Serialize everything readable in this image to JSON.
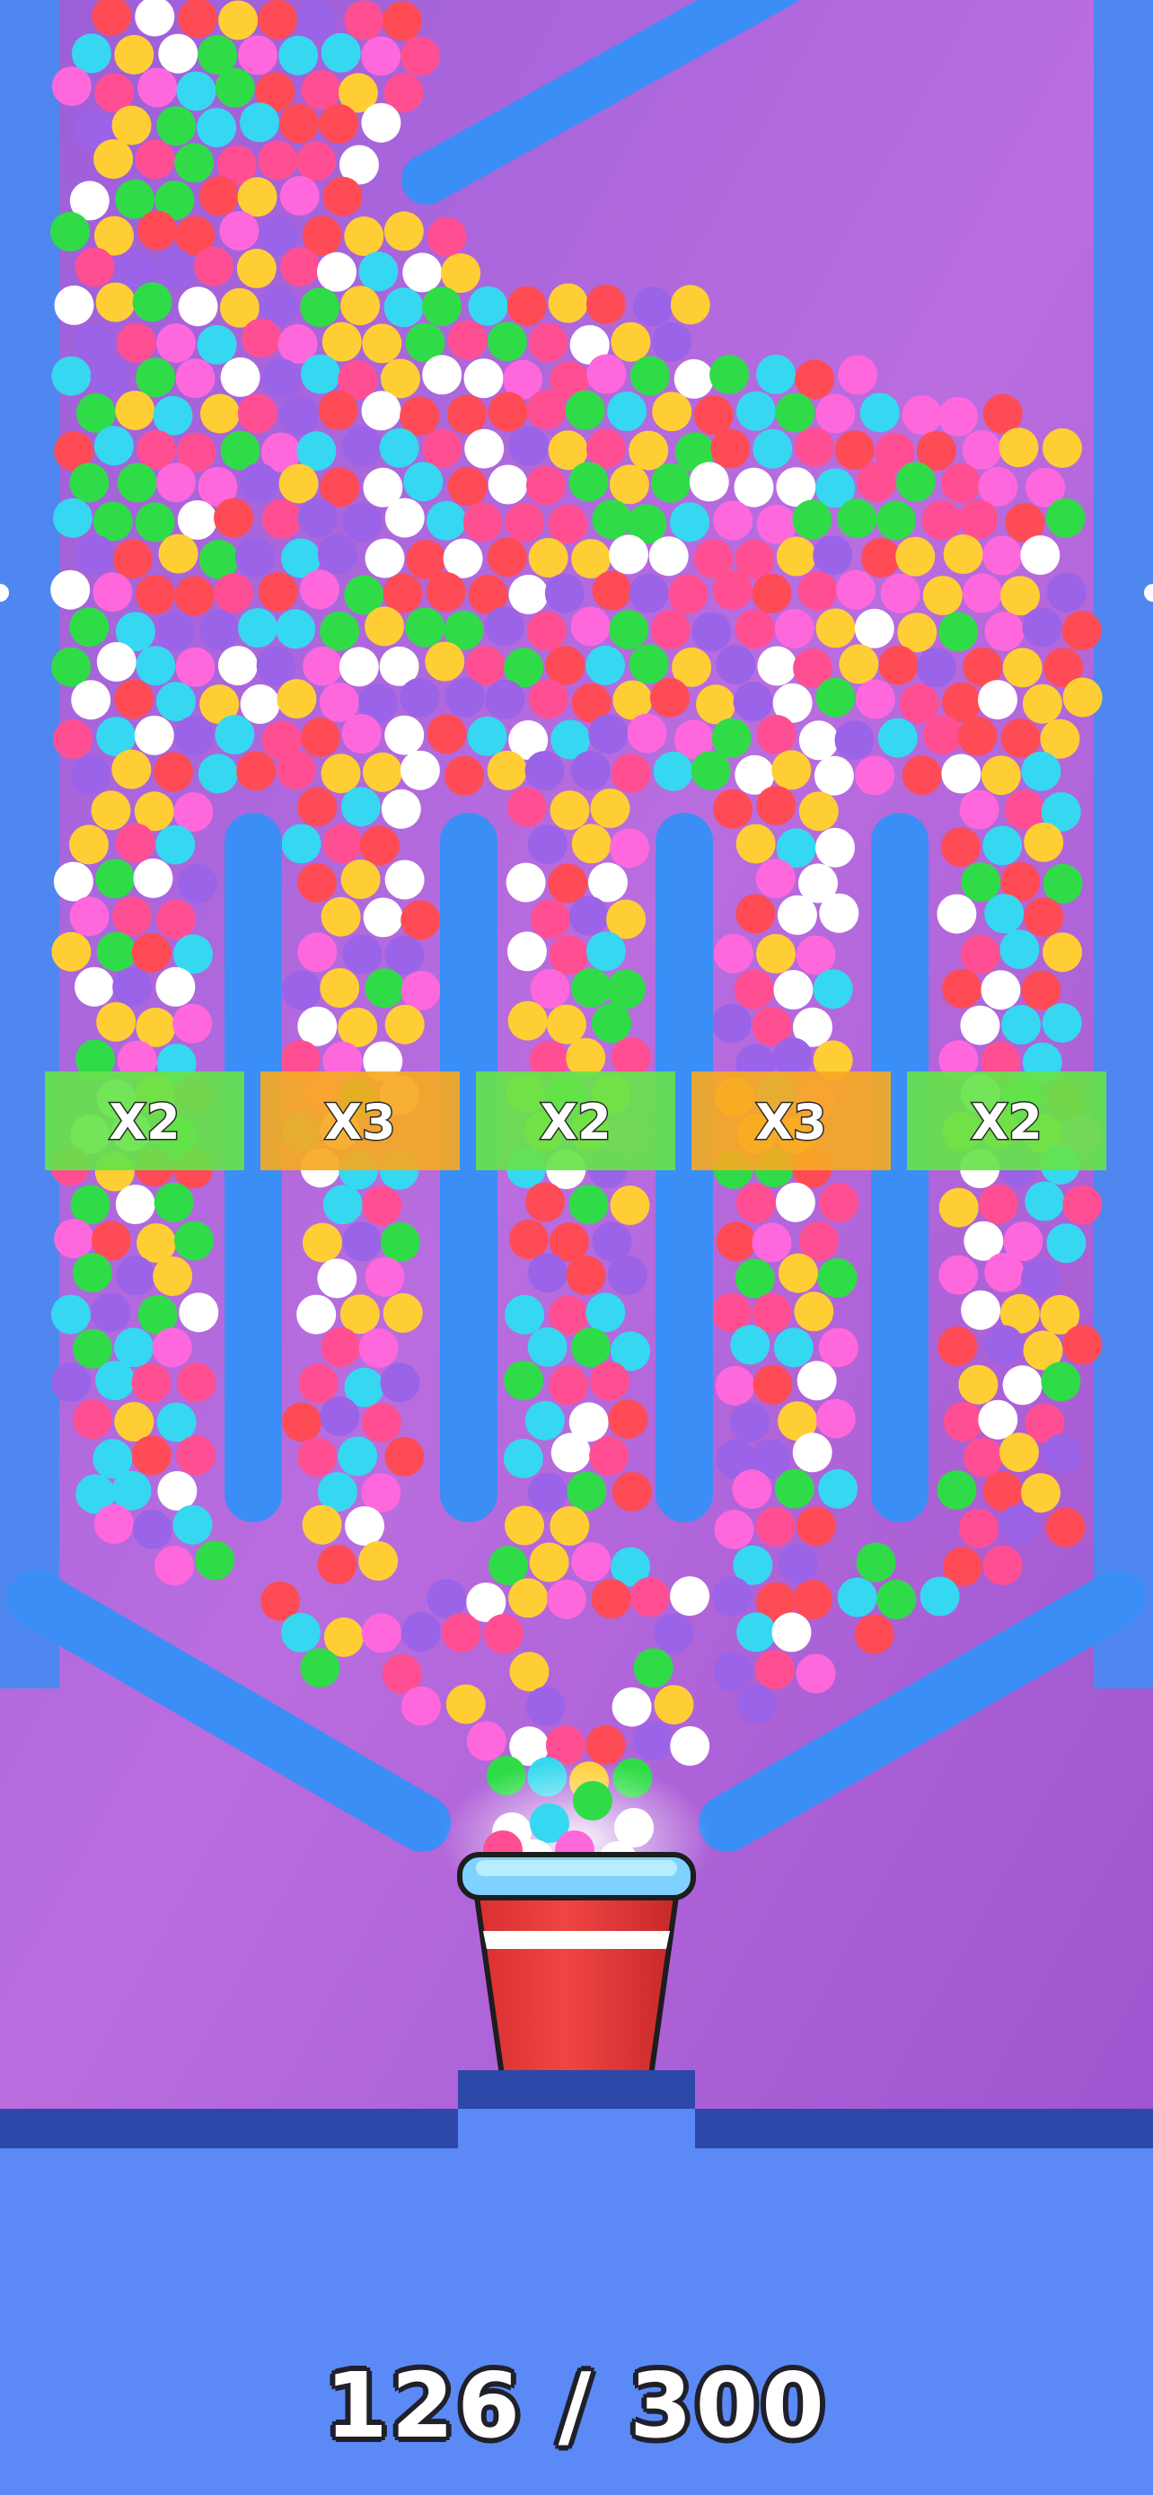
{
  "game": {
    "multipliers": [
      {
        "label": "X2",
        "kind": "x2"
      },
      {
        "label": "X3",
        "kind": "x3"
      },
      {
        "label": "X2",
        "kind": "x2"
      },
      {
        "label": "X3",
        "kind": "x3"
      },
      {
        "label": "X2",
        "kind": "x2"
      }
    ],
    "progress": {
      "text": "126 / 300",
      "collected": 126,
      "target": 300
    }
  },
  "colors": {
    "background_purple": "#a45ad3",
    "wall_blue": "#4f86f0",
    "channel_blue": "#3a8ef6",
    "floor_blue": "#5b8af7",
    "floor_dark": "#2c48a8",
    "gate_x2": "#66e34a",
    "gate_x3": "#f6a923",
    "cup_red": "#e63a3a",
    "cup_rim": "#7fd2ff"
  },
  "ball_colors": [
    "#ff4f92",
    "#ffce35",
    "#35d8f0",
    "#9a63e8",
    "#2fdc48",
    "#ff4b55",
    "#ffffff",
    "#ff68dc"
  ]
}
